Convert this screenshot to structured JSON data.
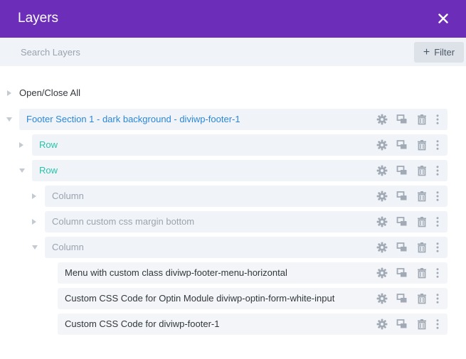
{
  "header": {
    "title": "Layers",
    "close_icon": "close-icon"
  },
  "search": {
    "placeholder": "Search Layers",
    "value": ""
  },
  "filter": {
    "label": "Filter",
    "icon": "plus-icon"
  },
  "open_close_all": {
    "label": "Open/Close All"
  },
  "colors": {
    "header_bg": "#6c2eb9",
    "section_text": "#2b87da",
    "row_text": "#29c4a9",
    "column_text": "#9aa3ae",
    "module_text": "#32373c",
    "row_bg": "#f0f3f8",
    "icon_color": "#a2abb5"
  },
  "layers": [
    {
      "type": "section",
      "label": "Footer Section 1 - dark background - diviwp-footer-1",
      "expanded": true
    },
    {
      "type": "row",
      "label": "Row",
      "expanded": false
    },
    {
      "type": "row",
      "label": "Row",
      "expanded": true
    },
    {
      "type": "column",
      "label": "Column",
      "expanded": false
    },
    {
      "type": "column",
      "label": "Column custom css margin bottom",
      "expanded": false
    },
    {
      "type": "column",
      "label": "Column",
      "expanded": true
    },
    {
      "type": "module",
      "label": "Menu with custom class diviwp-footer-menu-horizontal"
    },
    {
      "type": "module",
      "label": "Custom CSS Code for Optin Module diviwp-optin-form-white-input"
    },
    {
      "type": "module",
      "label": "Custom CSS Code for diviwp-footer-1"
    }
  ],
  "action_icons": [
    "gear-icon",
    "duplicate-icon",
    "trash-icon",
    "more-icon"
  ]
}
